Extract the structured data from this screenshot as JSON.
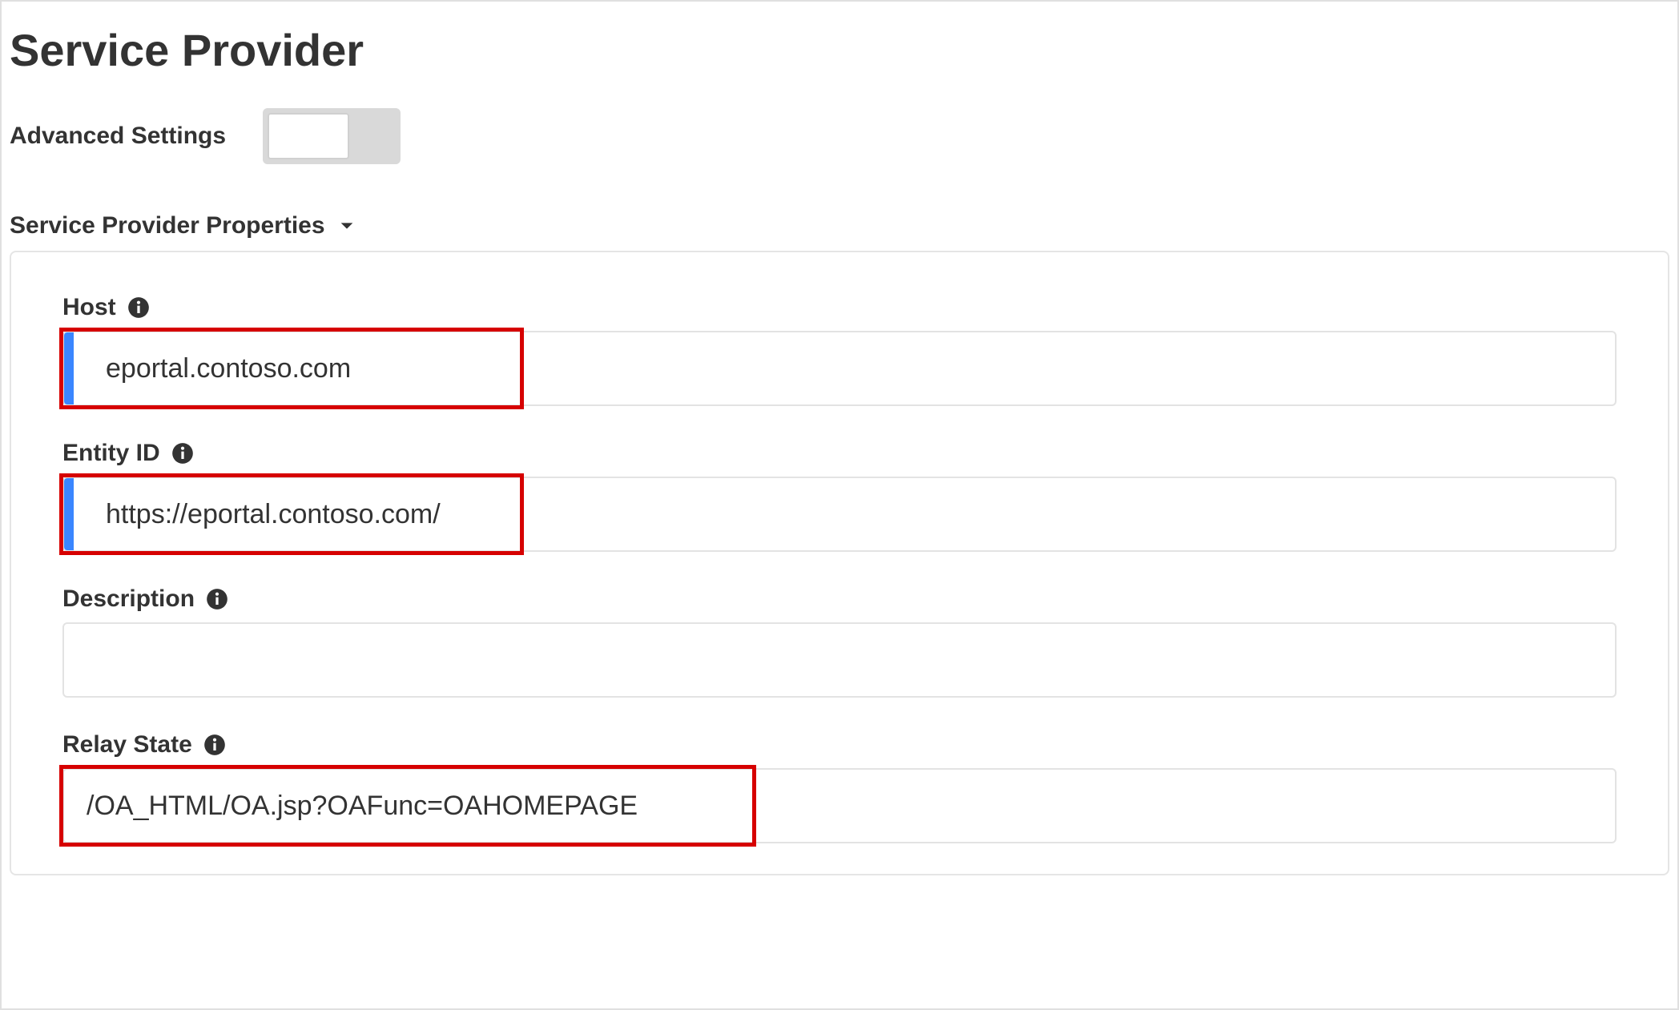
{
  "page": {
    "title": "Service Provider"
  },
  "advanced": {
    "label": "Advanced Settings",
    "enabled": false
  },
  "section": {
    "title": "Service Provider Properties"
  },
  "fields": {
    "host": {
      "label": "Host",
      "value": "eportal.contoso.com"
    },
    "entity_id": {
      "label": "Entity ID",
      "value": "https://eportal.contoso.com/"
    },
    "description": {
      "label": "Description",
      "value": ""
    },
    "relay_state": {
      "label": "Relay State",
      "value": "/OA_HTML/OA.jsp?OAFunc=OAHOMEPAGE"
    }
  }
}
